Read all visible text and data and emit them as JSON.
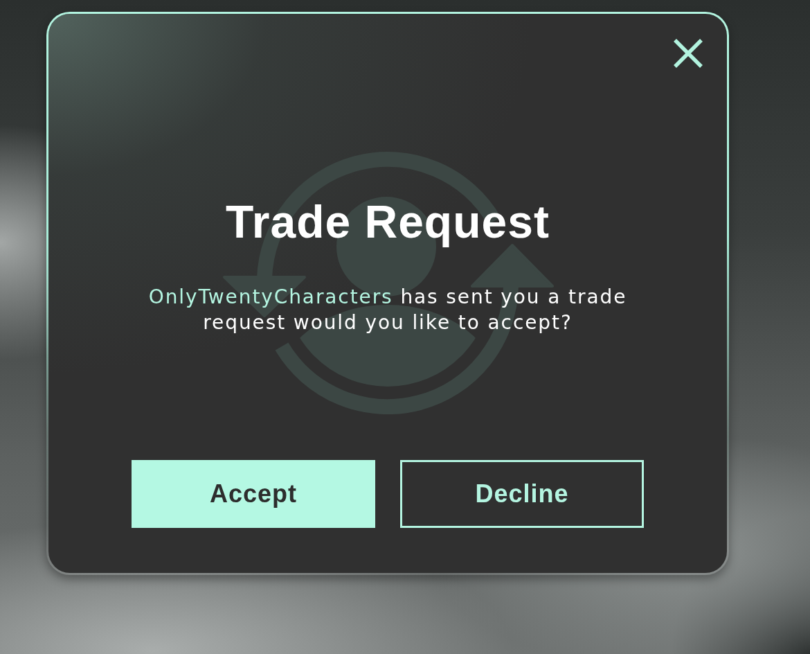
{
  "dialog": {
    "title": "Trade Request",
    "message": {
      "sender": "OnlyTwentyCharacters",
      "text": "has sent you a trade request would you like to accept?"
    },
    "buttons": [
      {
        "label": "Accept",
        "kind": "primary"
      },
      {
        "label": "Decline",
        "kind": "outline"
      }
    ]
  }
}
